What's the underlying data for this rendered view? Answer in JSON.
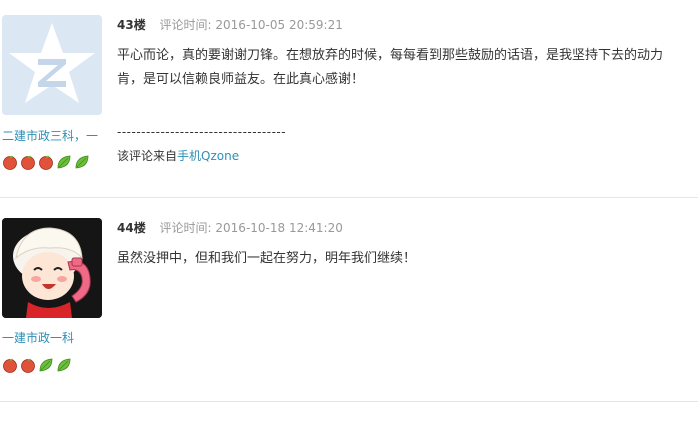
{
  "comments": [
    {
      "floor": "43楼",
      "time_label": "评论时间:",
      "time_value": "2016-10-05 20:59:21",
      "author": "二建市政三科，一",
      "avatar_icon": "qq-star-avatar-icon",
      "badges": [
        "apple-badge-icon",
        "apple-badge-icon",
        "apple-badge-icon",
        "leaf-badge-icon",
        "leaf-badge-icon"
      ],
      "body_lines": [
        "平心而论，真的要谢谢刀锋。在想放弃的时候，每每看到那些鼓励的话语，是我坚持下去的动力",
        "肯，是可以信赖良师益友。在此真心感谢！"
      ],
      "separator": "-----------------------------------",
      "source_prefix": "该评论来自",
      "source_link": "手机Qzone"
    },
    {
      "floor": "44楼",
      "time_label": "评论时间:",
      "time_value": "2016-10-18 12:41:20",
      "author": "一建市政一科",
      "avatar_icon": "cartoon-girl-phone-avatar-icon",
      "badges": [
        "apple-badge-icon",
        "apple-badge-icon",
        "leaf-badge-icon",
        "leaf-badge-icon"
      ],
      "body_lines": [
        "虽然没押中，但和我们一起在努力，明年我们继续！"
      ]
    }
  ],
  "colors": {
    "link": "#2f8fb5",
    "muted": "#999999",
    "divider": "#d8eaf0",
    "apple": "#e0533a",
    "leaf": "#6cbf3a"
  }
}
